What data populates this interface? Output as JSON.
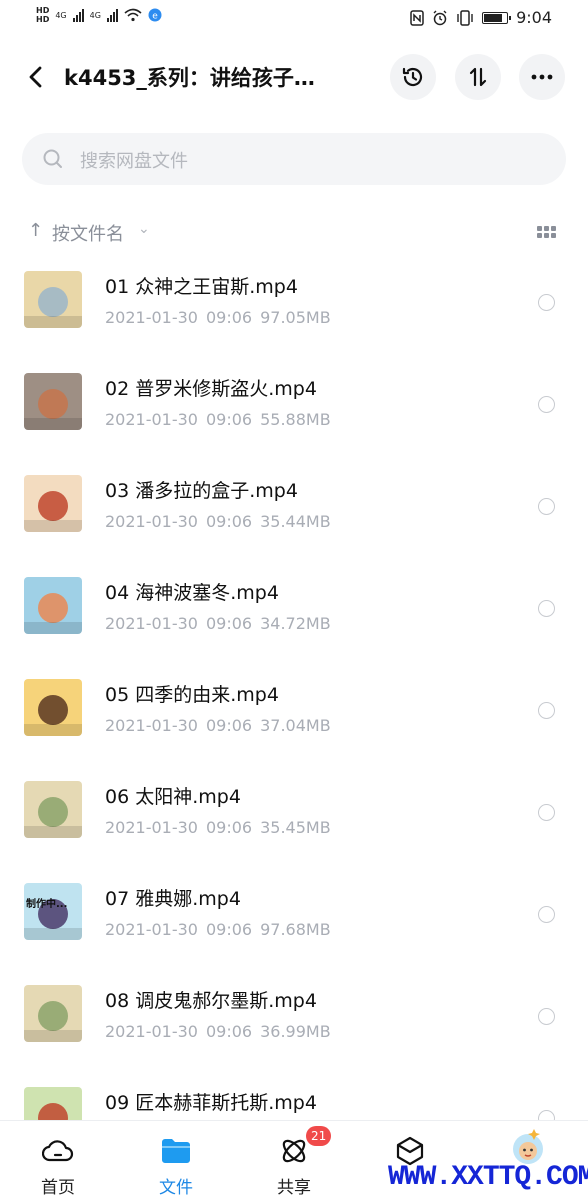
{
  "status_bar": {
    "network_labels": [
      "HD",
      "HD"
    ],
    "signal": [
      "4G",
      "4G"
    ],
    "time": "9:04"
  },
  "header": {
    "title": "k4453_系列：讲给孩子…",
    "icons": [
      "back-icon",
      "history-icon",
      "sort-icon",
      "more-icon"
    ]
  },
  "search": {
    "placeholder": "搜索网盘文件"
  },
  "sort": {
    "arrow": "↑",
    "label": "按文件名",
    "chevron": "⌄"
  },
  "files": [
    {
      "name": "01 众神之王宙斯.mp4",
      "date": "2021-01-30",
      "time": "09:06",
      "size": "97.05MB",
      "thumb_colors": [
        "#e9d7a8",
        "#9bb6c9"
      ]
    },
    {
      "name": "02 普罗米修斯盗火.mp4",
      "date": "2021-01-30",
      "time": "09:06",
      "size": "55.88MB",
      "thumb_colors": [
        "#9e8f84",
        "#c6764c"
      ]
    },
    {
      "name": "03 潘多拉的盒子.mp4",
      "date": "2021-01-30",
      "time": "09:06",
      "size": "35.44MB",
      "thumb_colors": [
        "#f3dcc0",
        "#c0462e"
      ]
    },
    {
      "name": "04 海神波塞冬.mp4",
      "date": "2021-01-30",
      "time": "09:06",
      "size": "34.72MB",
      "thumb_colors": [
        "#9fd0e6",
        "#e98a55"
      ]
    },
    {
      "name": "05 四季的由来.mp4",
      "date": "2021-01-30",
      "time": "09:06",
      "size": "37.04MB",
      "thumb_colors": [
        "#f6d37a",
        "#5a3722"
      ]
    },
    {
      "name": "06 太阳神.mp4",
      "date": "2021-01-30",
      "time": "09:06",
      "size": "35.45MB",
      "thumb_colors": [
        "#e5d9b4",
        "#8ca36b"
      ]
    },
    {
      "name": "07 雅典娜.mp4",
      "date": "2021-01-30",
      "time": "09:06",
      "size": "97.68MB",
      "thumb_colors": [
        "#bfe3f0",
        "#4a3b6b"
      ],
      "thumb_text": "制作中..."
    },
    {
      "name": "08 调皮鬼郝尔墨斯.mp4",
      "date": "2021-01-30",
      "time": "09:06",
      "size": "36.99MB",
      "thumb_colors": [
        "#e5d9b4",
        "#8ca36b"
      ]
    },
    {
      "name": "09 匠本赫菲斯托斯.mp4",
      "date": "",
      "time": "",
      "size": "",
      "thumb_colors": [
        "#cfe3b0",
        "#c0462e"
      ]
    }
  ],
  "bottom_nav": {
    "tabs": [
      {
        "label": "首页",
        "icon": "home-cloud-icon"
      },
      {
        "label": "文件",
        "icon": "folder-icon",
        "active": true
      },
      {
        "label": "共享",
        "icon": "share-atom-icon"
      },
      {
        "label": "",
        "icon": "box-icon"
      },
      {
        "label": "",
        "icon": "avatar-icon"
      }
    ],
    "share_badge": "21"
  },
  "watermark": "WWW.XXTTQ.COM",
  "colors": {
    "accent": "#1e88e5",
    "badge": "#f04a4a",
    "secondary_text": "#a9adb5",
    "search_bg": "#f4f5f7"
  }
}
